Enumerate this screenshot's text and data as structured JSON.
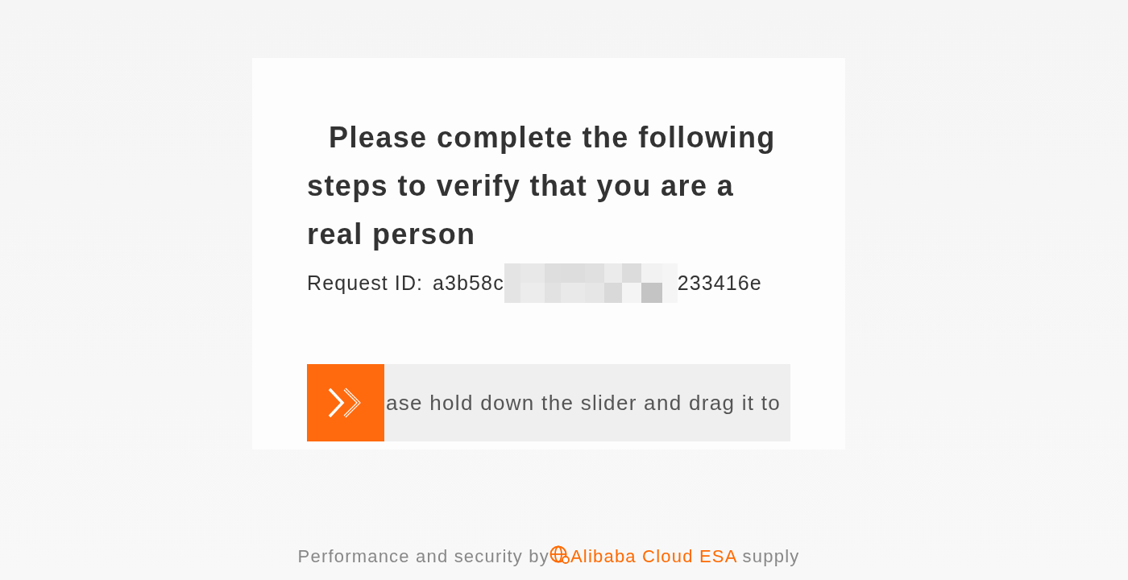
{
  "card": {
    "title": "Please complete the following steps to verify that you are a real person",
    "request_id": {
      "label": "Request ID:",
      "start": "a3b58c",
      "end": "233416e"
    },
    "slider": {
      "hint": "ase hold down the slider and drag it to",
      "level": 0
    }
  },
  "footer": {
    "prefix": "Performance and security by",
    "link": "Alibaba Cloud ESA",
    "suffix": "supply"
  }
}
